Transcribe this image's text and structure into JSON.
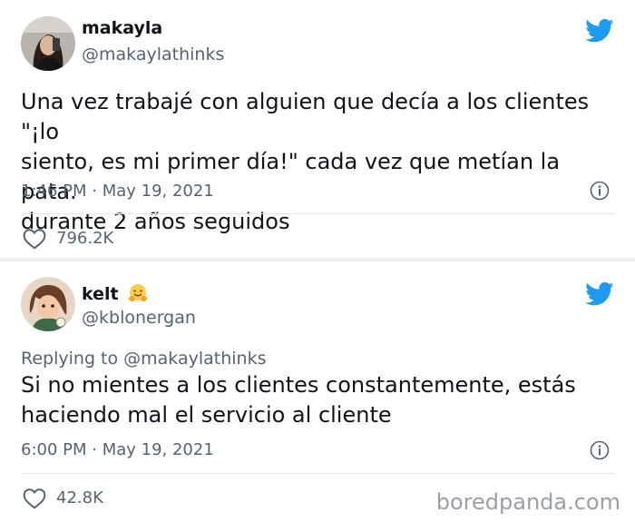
{
  "tweets": [
    {
      "name": "makayla",
      "handle": "@makaylathinks",
      "text_lines": [
        "Una vez trabajé con alguien que decía a los clientes \"¡lo",
        "siento, es mi primer día!\" cada vez que metían la pata.",
        "durante 2 años seguidos"
      ],
      "timestamp": "1:46 PM · May 19, 2021",
      "likes": "796.2K"
    },
    {
      "name": "kelt",
      "name_emoji": "hugging-face-emoji",
      "handle": "@kblonergan",
      "replying_to": "Replying to @makaylathinks",
      "text_lines": [
        "Si no mientes a los clientes constantemente, estás",
        "haciendo mal el servicio al cliente"
      ],
      "timestamp": "6:00 PM · May 19, 2021",
      "likes": "42.8K"
    }
  ],
  "watermark": "boredpanda.com",
  "colors": {
    "twitter_blue": "#1d9bf0",
    "muted_text": "#536471",
    "separator": "#eceef0"
  }
}
